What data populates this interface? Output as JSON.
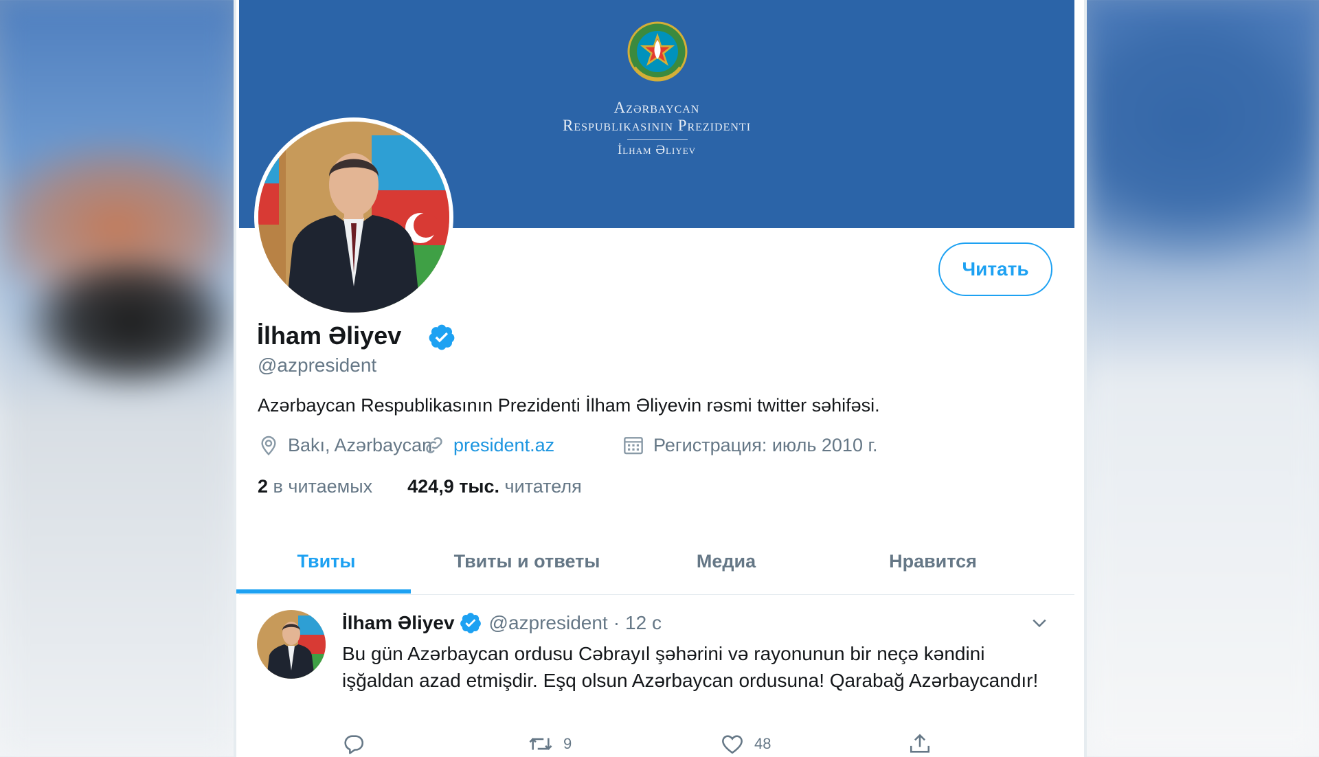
{
  "banner": {
    "line1": "Azərbaycan",
    "line2": "Respublikasının Prezidenti",
    "line3": "İlham Əliyev"
  },
  "profile": {
    "name": "İlham Əliyev",
    "handle": "@azpresident",
    "bio": "Azərbaycan Respublikasının Prezidenti İlham Əliyevin rəsmi twitter səhifəsi.",
    "location": "Bakı, Azərbaycan",
    "website": "president.az",
    "joined": "Регистрация: июль 2010 г.",
    "following_count": "2",
    "following_label": "в читаемых",
    "followers_count": "424,9 тыс.",
    "followers_label": "читателя",
    "follow_button": "Читать"
  },
  "tabs": [
    {
      "label": "Твиты",
      "active": true
    },
    {
      "label": "Твиты и ответы",
      "active": false
    },
    {
      "label": "Медиа",
      "active": false
    },
    {
      "label": "Нравится",
      "active": false
    }
  ],
  "tweet": {
    "name": "İlham Əliyev",
    "handle": "@azpresident",
    "separator": "·",
    "time": "12 с",
    "text": "Bu gün Azərbaycan ordusu Cəbrayıl şəhərini  və rayonunun bir neçə kəndini işğaldan azad etmişdir. Eşq olsun Azərbaycan ordusuna! Qarabağ Azərbaycandır!",
    "reply_count": "",
    "retweet_count": "9",
    "like_count": "48"
  },
  "icons": {
    "verified": "verified-badge-icon",
    "location": "location-pin-icon",
    "link": "link-icon",
    "calendar": "calendar-icon",
    "reply": "reply-icon",
    "retweet": "retweet-icon",
    "like": "heart-icon",
    "share": "share-icon",
    "caret": "chevron-down-icon"
  },
  "colors": {
    "accent": "#1da1f2",
    "banner": "#2b64a8",
    "text_primary": "#14171a",
    "text_secondary": "#657786"
  }
}
